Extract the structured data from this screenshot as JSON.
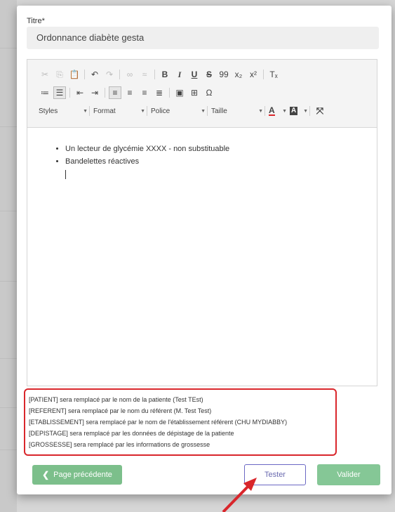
{
  "form": {
    "title_label": "Titre*",
    "title_value": "Ordonnance diabète gesta"
  },
  "toolbar": {
    "row1": [
      {
        "name": "cut-icon",
        "glyph": "✂",
        "state": "disabled"
      },
      {
        "name": "copy-icon",
        "glyph": "⎘",
        "state": "disabled"
      },
      {
        "name": "paste-icon",
        "glyph": "📋",
        "state": "normal"
      },
      {
        "name": "undo-icon",
        "glyph": "↶",
        "state": "normal"
      },
      {
        "name": "redo-icon",
        "glyph": "↷",
        "state": "disabled"
      },
      {
        "name": "link-icon",
        "glyph": "∞",
        "state": "disabled"
      },
      {
        "name": "unlink-icon",
        "glyph": "≈",
        "state": "disabled"
      },
      {
        "name": "bold-icon",
        "glyph": "B",
        "state": "normal"
      },
      {
        "name": "italic-icon",
        "glyph": "I",
        "state": "normal"
      },
      {
        "name": "underline-icon",
        "glyph": "U",
        "state": "normal"
      },
      {
        "name": "strikethrough-icon",
        "glyph": "S",
        "state": "normal"
      },
      {
        "name": "blockquote-icon",
        "glyph": "99",
        "state": "normal"
      },
      {
        "name": "subscript-icon",
        "glyph": "x₂",
        "state": "normal"
      },
      {
        "name": "superscript-icon",
        "glyph": "x²",
        "state": "normal"
      },
      {
        "name": "remove-format-icon",
        "glyph": "Tₓ",
        "state": "normal"
      }
    ],
    "row2": [
      {
        "name": "numbered-list-icon",
        "glyph": "≔",
        "state": "normal"
      },
      {
        "name": "bulleted-list-icon",
        "glyph": "☰",
        "state": "active"
      },
      {
        "name": "outdent-icon",
        "glyph": "⇤",
        "state": "normal"
      },
      {
        "name": "indent-icon",
        "glyph": "⇥",
        "state": "normal"
      },
      {
        "name": "align-left-icon",
        "glyph": "≡",
        "state": "active"
      },
      {
        "name": "align-center-icon",
        "glyph": "≡",
        "state": "normal"
      },
      {
        "name": "align-right-icon",
        "glyph": "≡",
        "state": "normal"
      },
      {
        "name": "justify-icon",
        "glyph": "≣",
        "state": "normal"
      },
      {
        "name": "image-icon",
        "glyph": "▣",
        "state": "normal"
      },
      {
        "name": "table-icon",
        "glyph": "⊞",
        "state": "normal"
      },
      {
        "name": "special-char-icon",
        "glyph": "Ω",
        "state": "normal"
      }
    ],
    "combos": {
      "styles": "Styles",
      "format": "Format",
      "police": "Police",
      "taille": "Taille"
    },
    "text_color_glyph": "A",
    "bg_color_glyph": "A",
    "maximize_glyph": "⤧"
  },
  "editor": {
    "items": [
      "Un lecteur de glycémie XXXX - non substituable",
      "Bandelettes réactives"
    ]
  },
  "placeholders": [
    "[PATIENT] sera remplacé par le nom de la patiente (Test TEst)",
    "[REFERENT] sera remplacé par le nom du référent (M. Test Test)",
    "[ETABLISSEMENT] sera remplacé par le nom de l'établissement référent (CHU MYDIABBY)",
    "[DEPISTAGE] sera remplacé par les données de dépistage de la patiente",
    "[GROSSESSE] sera remplacé par les informations de grossesse"
  ],
  "buttons": {
    "previous": "Page précédente",
    "previous_glyph": "❮",
    "test": "Tester",
    "validate": "Valider"
  },
  "colors": {
    "highlight_red": "#d9262b",
    "green": "#7cbf8b",
    "test_border": "#6b68c4"
  }
}
